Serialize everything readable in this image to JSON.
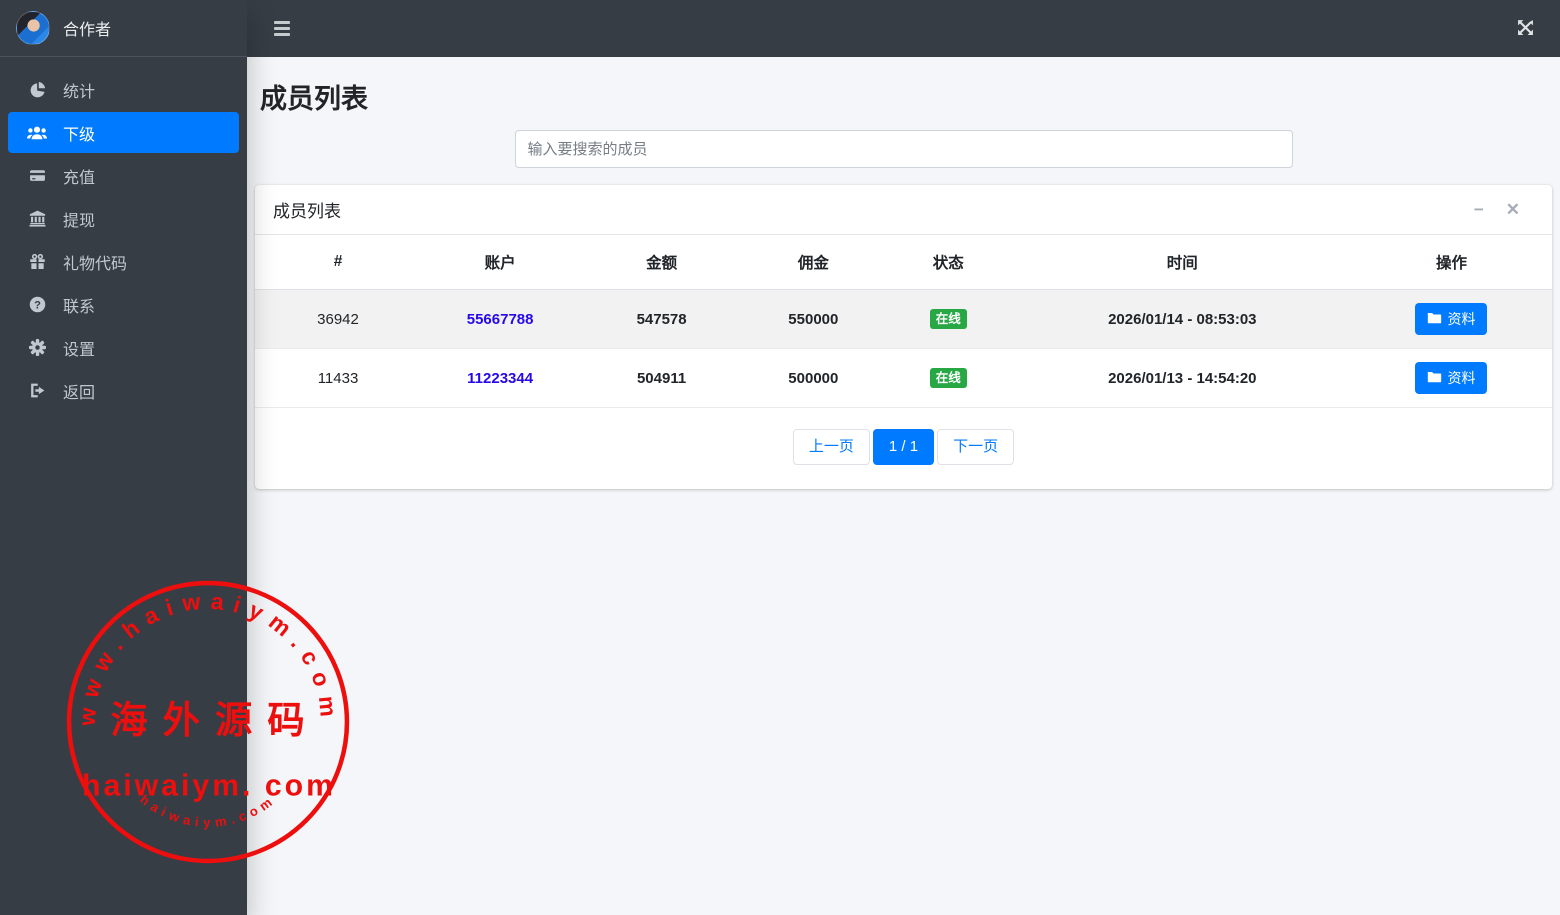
{
  "sidebar": {
    "brand": {
      "name": "合作者"
    },
    "items": [
      {
        "label": "统计",
        "icon": "pie-chart-icon",
        "active": false
      },
      {
        "label": "下级",
        "icon": "users-icon",
        "active": true
      },
      {
        "label": "充值",
        "icon": "credit-card-icon",
        "active": false
      },
      {
        "label": "提现",
        "icon": "bank-icon",
        "active": false
      },
      {
        "label": "礼物代码",
        "icon": "gift-icon",
        "active": false
      },
      {
        "label": "联系",
        "icon": "question-icon",
        "active": false
      },
      {
        "label": "设置",
        "icon": "gear-icon",
        "active": false
      },
      {
        "label": "返回",
        "icon": "logout-icon",
        "active": false
      }
    ]
  },
  "page": {
    "title": "成员列表"
  },
  "search": {
    "placeholder": "输入要搜索的成员",
    "value": ""
  },
  "card": {
    "title": "成员列表"
  },
  "table": {
    "headers": [
      "#",
      "账户",
      "金额",
      "佣金",
      "状态",
      "时间",
      "操作"
    ],
    "rows": [
      {
        "id": "36942",
        "account": "55667788",
        "amount": "547578",
        "commission": "550000",
        "status": "在线",
        "time": "2026/01/14 - 08:53:03",
        "action": "资料"
      },
      {
        "id": "11433",
        "account": "11223344",
        "amount": "504911",
        "commission": "500000",
        "status": "在线",
        "time": "2026/01/13 - 14:54:20",
        "action": "资料"
      }
    ]
  },
  "pagination": {
    "prev": "上一页",
    "current": "1 / 1",
    "next": "下一页"
  },
  "watermark": {
    "top_text": "www.haiwaiym.com",
    "center_text": "海外源码",
    "middle_text": "haiwaiym. com",
    "bottom_text": "haiwaiym.com"
  },
  "colors": {
    "accent": "#007bff",
    "success": "#28a745",
    "account_link": "#2609eb",
    "stamp_red": "#ed0e0e",
    "sidebar_bg": "#363d45",
    "content_bg": "#f4f6f9"
  }
}
